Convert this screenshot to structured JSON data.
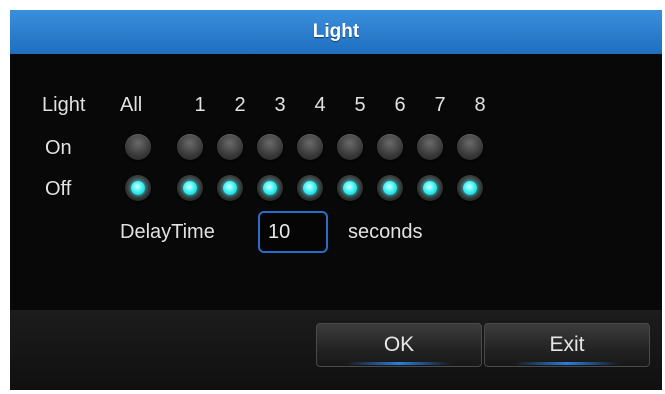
{
  "dialog": {
    "title": "Light",
    "header_label": "Light",
    "all_label": "All",
    "channels": [
      "1",
      "2",
      "3",
      "4",
      "5",
      "6",
      "7",
      "8"
    ],
    "on_label": "On",
    "off_label": "Off",
    "delay_label": "DelayTime",
    "delay_value": "10",
    "seconds_label": "seconds",
    "ok_label": "OK",
    "exit_label": "Exit",
    "selected_state": "Off",
    "accent_color": "#21e0e8",
    "title_color": "#2a7fd4"
  }
}
